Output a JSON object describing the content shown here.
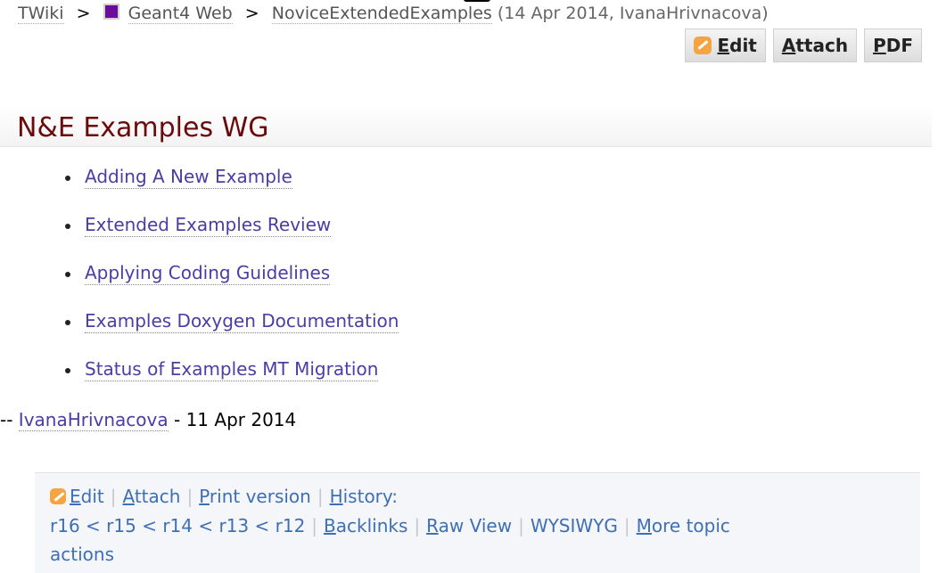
{
  "breadcrumb": {
    "root": "TWiki",
    "separator": ">",
    "web": "Geant4 Web",
    "topic": "NoviceExtendedExamples",
    "meta": "(14 Apr 2014, IvanaHrivnacova)"
  },
  "toolbar": {
    "edit_u": "E",
    "edit_rest": "dit",
    "attach_u": "A",
    "attach_rest": "ttach",
    "pdf_u": "P",
    "pdf_rest": "DF"
  },
  "page": {
    "title": "N&E Examples WG"
  },
  "topics": [
    "Adding A New Example",
    "Extended Examples Review",
    "Applying Coding Guidelines",
    "Examples Doxygen Documentation",
    "Status of Examples MT Migration"
  ],
  "signature": {
    "prefix": "--",
    "author": "IvanaHrivnacova",
    "date": "- 11 Apr 2014"
  },
  "footer": {
    "edit": "Edit",
    "attach": "Attach",
    "print": "Print version",
    "history": "History:",
    "r16": "r16",
    "lt": "<",
    "r15": "r15",
    "r14": "r14",
    "r13": "r13",
    "r12": "r12",
    "backlinks": "Backlinks",
    "raw_view": "Raw View",
    "wysiwyg": "WYSIWYG",
    "more_actions_line1": "More topic",
    "more_actions_line2": "actions",
    "pipe": "|"
  },
  "colors": {
    "title": "#6b0a0a",
    "link": "#4a3da5",
    "footer_link": "#3e6fb4",
    "web_square": "#6a0d9a"
  },
  "icons": {
    "edit": "edit-pencil-icon",
    "web": "web-color-square-icon"
  }
}
